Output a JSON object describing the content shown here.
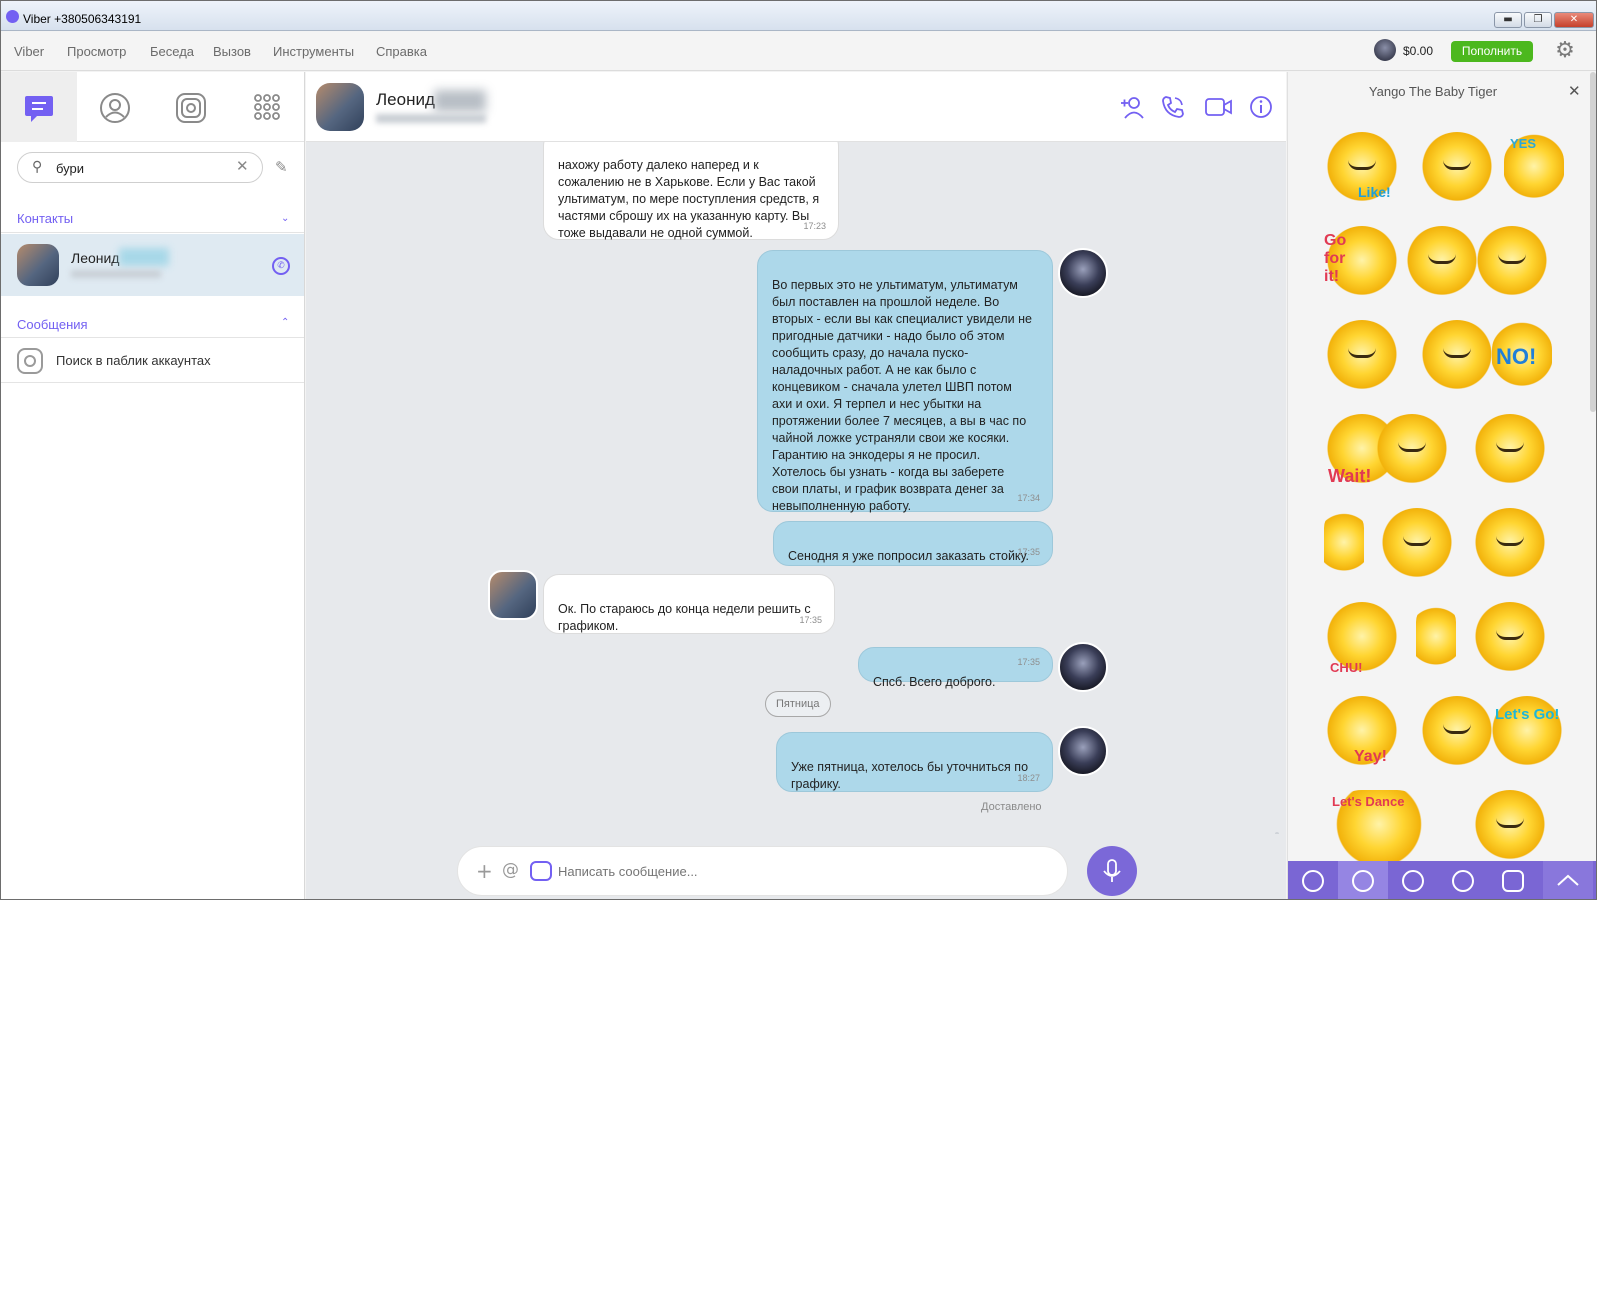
{
  "window": {
    "title": "Viber +380506343191",
    "buttons": {
      "minimize": "▬",
      "maximize": "❐",
      "close": "✕"
    }
  },
  "menu": {
    "items": [
      "Viber",
      "Просмотр",
      "Беседа",
      "Вызов",
      "Инструменты",
      "Справка"
    ],
    "balance": "$0.00",
    "topup_label": "Пополнить",
    "settings_icon": "gear-icon"
  },
  "left": {
    "tabs": [
      "chats-icon",
      "contacts-icon",
      "public-accounts-icon",
      "dialpad-icon"
    ],
    "search": {
      "value": "бури",
      "placeholder": ""
    },
    "contacts_header": "Контакты",
    "contact": {
      "name": "Леонид"
    },
    "messages_header": "Сообщения",
    "public_search_label": "Поиск в паблик аккаунтах"
  },
  "chat": {
    "contact_name": "Леонид",
    "header_icons": [
      "add-contact-icon",
      "call-icon",
      "video-call-icon",
      "info-icon"
    ],
    "messages": [
      {
        "dir": "in",
        "text": "нахожу работу далеко наперед и к\nсожалению не в Харькове. Если у Вас такой\nультиматум, по мере поступления средств, я\nчастями сброшу их на указанную карту. Вы\nтоже выдавали не одной суммой.",
        "time": "17:23"
      },
      {
        "dir": "out",
        "text": "Во первых это не ультиматум, ультиматум\nбыл поставлен на прошлой неделе. Во\nвторых - если вы как специалист увидели не\nпригодные датчики - надо было об этом\nсообщить сразу,  до начала пуско-\nналадочных работ. А не как было с\nконцевиком - сначала улетел ШВП потом\nахи и охи.  Я терпел и нес убытки на\nпротяжении более 7 месяцев, а вы в час по\nчайной ложке устраняли свои же косяки.\nГарантию на энкодеры я не просил.\nХотелось бы узнать - когда вы заберете\nсвои платы,  и график возврата денег за\nневыполненную работу.",
        "time": "17:34"
      },
      {
        "dir": "out",
        "text": "Сенодня я уже попросил заказать стойку.",
        "time": "17:35"
      },
      {
        "dir": "in",
        "text": "Ок. По стараюсь до конца недели решить с\nграфиком.",
        "time": "17:35"
      },
      {
        "dir": "out",
        "text": "Спсб.  Всего доброго.",
        "time": "17:35"
      },
      {
        "dir": "out",
        "text": "Уже пятница,  хотелось бы уточниться по\nграфику.",
        "time": "18:27"
      }
    ],
    "day_separator": "Пятница",
    "delivered": "Доставлено",
    "composer_placeholder": "Написать сообщение..."
  },
  "stickers": {
    "pack_title": "Yango The Baby Tiger",
    "tags": [
      "Like!",
      "YES",
      "Go for it!",
      "NO!",
      "Wait!",
      "CHU!",
      "Yay!",
      "Let's Go!",
      "Let's Dance"
    ],
    "bar_icons": [
      "emoji-icon",
      "sticker-bear-icon",
      "hi-icon",
      "sticker-girl-icon",
      "wave-hand-icon",
      "chevron-up-icon"
    ]
  },
  "colors": {
    "accent": "#7360f2",
    "outgoing_bubble": "#add8ea",
    "topup_green": "#4cb81e",
    "sticker_bar": "#7a66d4"
  }
}
